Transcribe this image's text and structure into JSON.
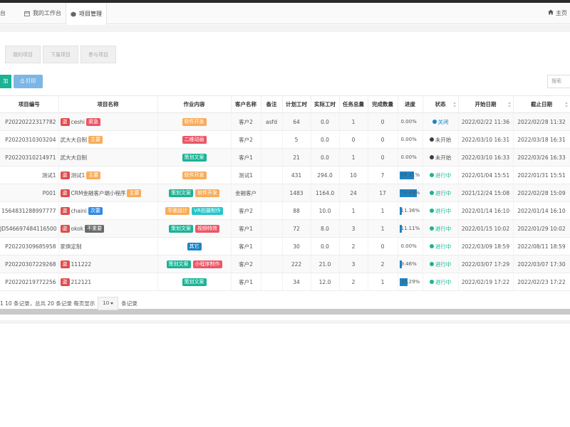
{
  "tabbar": {
    "tabs": [
      {
        "label": "台",
        "icon": "none"
      },
      {
        "label": "我的工作台",
        "icon": "calendar-icon"
      },
      {
        "label": "项目管理",
        "icon": "cube-icon"
      }
    ],
    "home_label": "主页"
  },
  "subtabs": [
    "我的项目",
    "下属项目",
    "参与项目"
  ],
  "toolbar": {
    "add_label": "加",
    "print_label": "打印",
    "search_placeholder": "搜索"
  },
  "columns": [
    "项目编号",
    "项目名称",
    "作业内容",
    "客户名称",
    "备注",
    "计划工时",
    "实际工时",
    "任务总量",
    "完成数量",
    "进度",
    "状态",
    "开始日期",
    "截止日期"
  ],
  "colors": {
    "red": "#ed5565",
    "orange": "#f8ac59",
    "blue": "#23c6c8",
    "teal": "#1ab394",
    "primary": "#1c84c6",
    "gray": "#676a6c",
    "brightblue": "#2f8be6",
    "darkred": "#e04b4b"
  },
  "rows": [
    {
      "id": "P20220222317782",
      "badge": "盗",
      "name": "ceshi",
      "tag": {
        "label": "紧急",
        "color": "#ed5565"
      },
      "work": [
        {
          "label": "软件开发",
          "color": "#f8ac59"
        }
      ],
      "customer": "客户2",
      "note": "asfd",
      "plan": "64",
      "actual": "0.0",
      "total": "1",
      "done": "0",
      "progress": "0.00%",
      "progress_value": 0,
      "status": "关闭",
      "status_color": "#1c84c6",
      "status_text_color": "#1c84c6",
      "start": "2022/02/22 11:36",
      "end": "2022/02/28 11:32"
    },
    {
      "id": "P20220310303204",
      "badge": "",
      "name": "武大大自制",
      "tag": {
        "label": "主要",
        "color": "#f8ac59"
      },
      "work": [
        {
          "label": "二维动画",
          "color": "#ed5565"
        }
      ],
      "customer": "客户2",
      "note": "",
      "plan": "5",
      "actual": "0.0",
      "total": "0",
      "done": "0",
      "progress": "0.00%",
      "progress_value": 0,
      "status": "未开始",
      "status_color": "#2f4050",
      "status_text_color": "#555555",
      "start": "2022/03/10 16:31",
      "end": "2022/03/18 16:31"
    },
    {
      "id": "P20220310214971",
      "badge": "",
      "name": "武大大自制",
      "tag": null,
      "work": [
        {
          "label": "策划文案",
          "color": "#1ab394"
        }
      ],
      "customer": "客户1",
      "note": "",
      "plan": "21",
      "actual": "0.0",
      "total": "1",
      "done": "0",
      "progress": "0.00%",
      "progress_value": 0,
      "status": "未开始",
      "status_color": "#2f4050",
      "status_text_color": "#555555",
      "start": "2022/03/10 16:33",
      "end": "2022/03/26 16:33"
    },
    {
      "id": "测试1",
      "badge": "盗",
      "name": "测试1",
      "tag": {
        "label": "主要",
        "color": "#f8ac59"
      },
      "work": [
        {
          "label": "软件开发",
          "color": "#f8ac59"
        }
      ],
      "customer": "测试1",
      "note": "",
      "plan": "431",
      "actual": "294.0",
      "total": "10",
      "done": "7",
      "progress": "68.21%",
      "progress_value": 0.6821,
      "status": "进行中",
      "status_color": "#1ab394",
      "status_text_color": "#1ab394",
      "start": "2022/01/04 15:51",
      "end": "2022/01/31 15:51"
    },
    {
      "id": "P001",
      "badge": "盗",
      "name": "CRM金融客户端小程序",
      "tag": {
        "label": "主要",
        "color": "#f8ac59"
      },
      "work": [
        {
          "label": "策划文案",
          "color": "#1ab394"
        },
        {
          "label": "软件开发",
          "color": "#f8ac59"
        }
      ],
      "customer": "金融客户",
      "note": "",
      "plan": "1483",
      "actual": "1164.0",
      "total": "24",
      "done": "17",
      "progress": "78.49%",
      "progress_value": 0.7849,
      "status": "进行中",
      "status_color": "#1ab394",
      "status_text_color": "#1ab394",
      "start": "2021/12/24 15:08",
      "end": "2022/02/28 15:09"
    },
    {
      "id": "1564831288997777",
      "badge": "盗",
      "name": "chaini",
      "tag": {
        "label": "次要",
        "color": "#2f8be6"
      },
      "work": [
        {
          "label": "平面设计",
          "color": "#f8ac59"
        },
        {
          "label": "VR拍摄制作",
          "color": "#23c6c8"
        }
      ],
      "customer": "客户2",
      "note": "",
      "plan": "88",
      "actual": "10.0",
      "total": "1",
      "done": "1",
      "progress": "11.36%",
      "progress_value": 0.1136,
      "status": "进行中",
      "status_color": "#1ab394",
      "status_text_color": "#1ab394",
      "start": "2022/01/14 16:10",
      "end": "2022/01/14 16:10"
    },
    {
      "id": "JD546697484116500",
      "badge": "盗",
      "name": "okok",
      "tag": {
        "label": "不重要",
        "color": "#676a6c"
      },
      "work": [
        {
          "label": "策划文案",
          "color": "#1ab394"
        },
        {
          "label": "视频特效",
          "color": "#ed5565"
        }
      ],
      "customer": "客户1",
      "note": "",
      "plan": "72",
      "actual": "8.0",
      "total": "3",
      "done": "1",
      "progress": "11.11%",
      "progress_value": 0.1111,
      "status": "进行中",
      "status_color": "#1ab394",
      "status_text_color": "#1ab394",
      "start": "2022/01/15 10:02",
      "end": "2022/01/29 10:02"
    },
    {
      "id": "P20220309685958",
      "badge": "",
      "name": "家俱定制",
      "tag": null,
      "work": [
        {
          "label": "其它",
          "color": "#1c84c6"
        }
      ],
      "customer": "客户1",
      "note": "",
      "plan": "30",
      "actual": "0.0",
      "total": "2",
      "done": "0",
      "progress": "0.00%",
      "progress_value": 0,
      "status": "进行中",
      "status_color": "#1ab394",
      "status_text_color": "#1ab394",
      "start": "2022/03/09 18:59",
      "end": "2022/08/11 18:59"
    },
    {
      "id": "P20220307229268",
      "badge": "盗",
      "name": "111222",
      "tag": null,
      "work": [
        {
          "label": "策划文案",
          "color": "#1ab394"
        },
        {
          "label": "小程序制作",
          "color": "#ed5565"
        }
      ],
      "customer": "客户2",
      "note": "",
      "plan": "222",
      "actual": "21.0",
      "total": "3",
      "done": "2",
      "progress": "9.46%",
      "progress_value": 0.0946,
      "status": "进行中",
      "status_color": "#1ab394",
      "status_text_color": "#1ab394",
      "start": "2022/03/07 17:29",
      "end": "2022/03/07 17:30"
    },
    {
      "id": "P20220219772256",
      "badge": "盗",
      "name": "212121",
      "tag": null,
      "work": [
        {
          "label": "策划文案",
          "color": "#1ab394"
        }
      ],
      "customer": "客户1",
      "note": "",
      "plan": "34",
      "actual": "12.0",
      "total": "2",
      "done": "1",
      "progress": "35.29%",
      "progress_value": 0.3529,
      "status": "进行中",
      "status_color": "#1ab394",
      "status_text_color": "#1ab394",
      "start": "2022/02/19 17:22",
      "end": "2022/02/23 17:22"
    }
  ],
  "pager": {
    "range_text": "1 10 条记录，总共 20 条记录 每页显示",
    "page_size": "10",
    "suffix": "条记录"
  }
}
